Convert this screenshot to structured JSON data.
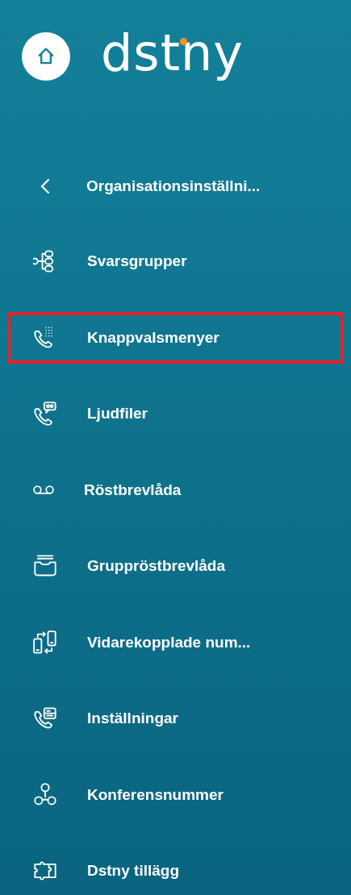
{
  "logo": {
    "text": "dstny"
  },
  "back": {
    "label": "Organisationsinställni..."
  },
  "menu": [
    {
      "label": "Svarsgrupper",
      "highlighted": false
    },
    {
      "label": "Knappvalsmenyer",
      "highlighted": true
    },
    {
      "label": "Ljudfiler",
      "highlighted": false
    },
    {
      "label": "Röstbrevlåda",
      "highlighted": false
    },
    {
      "label": "Gruppröstbrevlåda",
      "highlighted": false
    },
    {
      "label": "Vidarekopplade num...",
      "highlighted": false
    },
    {
      "label": "Inställningar",
      "highlighted": false
    },
    {
      "label": "Konferensnummer",
      "highlighted": false
    },
    {
      "label": "Dstny tillägg",
      "highlighted": false
    }
  ]
}
